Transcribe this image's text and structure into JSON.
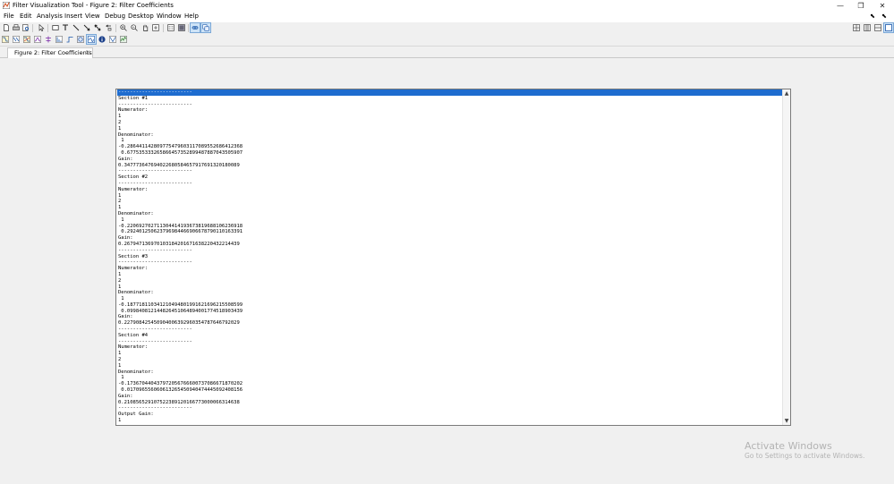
{
  "window": {
    "title": "Filter Visualization Tool - Figure 2: Filter Coefficients",
    "controls": {
      "minimize": "—",
      "restore": "❐",
      "close": "✕"
    }
  },
  "menu": {
    "items": [
      "File",
      "Edit",
      "Analysis",
      "Insert",
      "View",
      "Debug",
      "Desktop",
      "Window",
      "Help"
    ],
    "undock": "⬉"
  },
  "toolbar": {
    "row1": [
      "new-file-icon",
      "print-icon",
      "print-preview-icon",
      "select-arrow-icon",
      "rectangle-icon",
      "text-icon",
      "line-icon",
      "arrow-icon",
      "double-arrow-icon",
      "zoom-in-icon",
      "zoom-out-icon",
      "pan-icon",
      "data-cursor-icon",
      "legend-icon",
      "colorbar-icon",
      "link-icon",
      "inspector-icon"
    ],
    "row2": [
      "magnitude-response-icon",
      "phase-response-icon",
      "mag-phase-icon",
      "group-delay-icon",
      "phase-delay-icon",
      "impulse-response-icon",
      "step-response-icon",
      "pole-zero-icon",
      "filter-coefficients-icon",
      "filter-info-icon",
      "magnitude-estimate-icon",
      "noise-power-icon"
    ],
    "layout": [
      "tile-grid-icon",
      "tile-columns-icon",
      "tile-rows-icon",
      "single-view-icon"
    ]
  },
  "tabs": [
    {
      "label": "Figure 2: Filter Coefficients",
      "close": "✕"
    }
  ],
  "coefficients": {
    "lines": [
      "-------------------------",
      "Section #1",
      "-------------------------",
      "Numerator:",
      "1",
      "2",
      "1",
      "Denominator:",
      " 1",
      "-0.286441142809775479603117089552686412368",
      " 0.677535333265866457352899487887043505907",
      "Gain:",
      "0.347773647694022680584657917691320180089",
      "-------------------------",
      "Section #2",
      "-------------------------",
      "Numerator:",
      "1",
      "2",
      "1",
      "Denominator:",
      " 1",
      "-0.220692702711304414193673819688106236918",
      " 0.292401250623796984466906678790110163391",
      "Gain:",
      "0.267947136970103184201671638220432214439",
      "-------------------------",
      "Section #3",
      "-------------------------",
      "Numerator:",
      "1",
      "2",
      "1",
      "Denominator:",
      " 1",
      "-0.187718110341210494801991621696215508599",
      " 0.099840812144826451064894001774518903439",
      "Gain:",
      "0.227908425450904006392960354787646792029",
      "-------------------------",
      "Section #4",
      "-------------------------",
      "Numerator:",
      "1",
      "2",
      "1",
      "Denominator:",
      " 1",
      "-0.173670440437972056766600737086671870202",
      " 0.017096556060613265450940474445092408156",
      "Gain:",
      "0.210856529107522389120166773000066314638",
      "-------------------------",
      "Output Gain:",
      "1"
    ],
    "selected_line": 0,
    "scroll_up": "▲",
    "scroll_down": "▼"
  },
  "watermark": {
    "title": "Activate Windows",
    "subtitle": "Go to Settings to activate Windows."
  },
  "colors": {
    "selection": "#1e6ccf",
    "watermark": "#b3b3b3"
  }
}
